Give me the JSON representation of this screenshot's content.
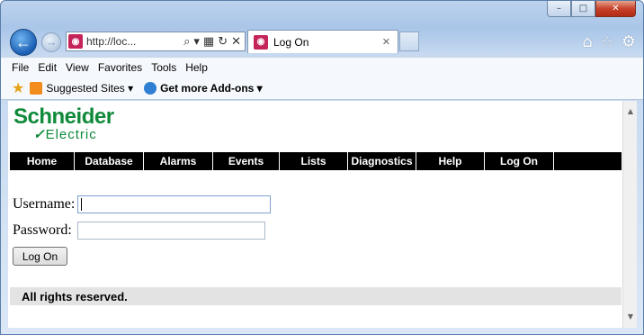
{
  "window": {
    "caption": {
      "minimize": "–",
      "maximize": "□",
      "close": "✕"
    }
  },
  "browser": {
    "back": "←",
    "forward": "→",
    "address": "http://loc...",
    "address_icons": [
      "⌕",
      "▾",
      "▦",
      "↻",
      "✕"
    ],
    "tab": {
      "title": "Log On",
      "close": "✕"
    },
    "right_icons": {
      "home": "⌂",
      "favorites": "☆",
      "tools": "⚙"
    }
  },
  "menu_bar": {
    "items": [
      {
        "label": "File"
      },
      {
        "label": "Edit"
      },
      {
        "label": "View"
      },
      {
        "label": "Favorites"
      },
      {
        "label": "Tools"
      },
      {
        "label": "Help"
      }
    ]
  },
  "favorites_bar": {
    "star": "★",
    "items": [
      {
        "label": "Suggested Sites ▾",
        "color": "#f28c1c"
      },
      {
        "label": "Get more Add-ons ▾",
        "color": "#2f7fd3"
      }
    ]
  },
  "page": {
    "logo": {
      "top": "Schneider",
      "mark": "✓",
      "bottom": "Electric"
    },
    "nav": [
      {
        "label": "Home"
      },
      {
        "label": "Database"
      },
      {
        "label": "Alarms"
      },
      {
        "label": "Events"
      },
      {
        "label": "Lists"
      },
      {
        "label": "Diagnostics"
      },
      {
        "label": "Help"
      },
      {
        "label": "Log On"
      }
    ],
    "form": {
      "username_label": "Username:",
      "password_label": "Password:",
      "submit": "Log On"
    },
    "footer": "All rights reserved."
  },
  "scrollbar": {
    "up": "▲",
    "down": "▼"
  },
  "colors": {
    "brand_green": "#0f8a3b"
  }
}
